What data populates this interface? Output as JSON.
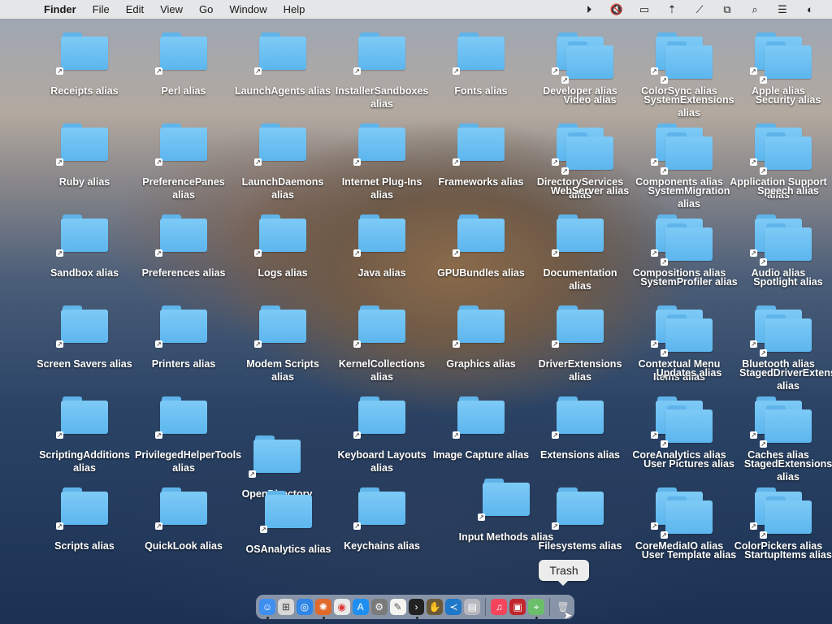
{
  "menubar": {
    "apple": "",
    "app": "Finder",
    "items": [
      "File",
      "Edit",
      "View",
      "Go",
      "Window",
      "Help"
    ],
    "status_icons": [
      "play-icon",
      "mute-icon",
      "display-icon",
      "airdrop-icon",
      "wifi-off-icon",
      "mirroring-icon",
      "search-icon",
      "control-center-icon",
      "siri-icon"
    ]
  },
  "desktop_labels": {
    "r0": [
      "Receipts alias",
      "Perl alias",
      "LaunchAgents alias",
      "InstallerSandboxes alias",
      "Fonts alias",
      "Developer alias",
      "ColorSync alias",
      "Apple alias"
    ],
    "r0b": [
      "Video alias",
      "SystemExtensions alias",
      "Security alias"
    ],
    "r1": [
      "Ruby alias",
      "PreferencePanes alias",
      "LaunchDaemons alias",
      "Internet Plug-Ins alias",
      "Frameworks alias",
      "DirectoryServices alias",
      "Components alias",
      "Application Support alias"
    ],
    "r1b": [
      "WebServer alias",
      "SystemMigration alias",
      "Speech alias"
    ],
    "r2": [
      "Sandbox alias",
      "Preferences alias",
      "Logs alias",
      "Java alias",
      "GPUBundles alias",
      "Documentation alias",
      "Compositions alias",
      "Audio alias"
    ],
    "r2b": [
      "SystemProfiler alias",
      "Spotlight alias"
    ],
    "r3": [
      "Screen Savers alias",
      "Printers alias",
      "Modem Scripts alias",
      "KernelCollections alias",
      "Graphics alias",
      "DriverExtensions alias",
      "Contextual Menu Items alias",
      "Bluetooth alias"
    ],
    "r3b": [
      "Updates alias",
      "StagedDriverExtensions alias"
    ],
    "r4": [
      "ScriptingAdditions alias",
      "PrivilegedHelperTools alias",
      "OpenDirectory",
      "Keyboard Layouts alias",
      "Image Capture alias",
      "Extensions alias",
      "CoreAnalytics alias",
      "Caches alias"
    ],
    "r4b": [
      "User Pictures alias",
      "StagedExtensions alias"
    ],
    "r5": [
      "Scripts alias",
      "QuickLook alias",
      "OSAnalytics alias",
      "Keychains alias",
      "Input Methods alias",
      "Filesystems alias",
      "CoreMediaIO alias",
      "ColorPickers alias"
    ],
    "r5b": [
      "User Template alias",
      "StartupItems alias"
    ]
  },
  "tooltip": {
    "text": "Trash"
  },
  "dock": {
    "apps": [
      "finder-icon",
      "launchpad-icon",
      "safari-icon",
      "firefox-icon",
      "chrome-icon",
      "app-store-icon",
      "system-preferences-icon",
      "textedit-icon",
      "terminal-icon",
      "automator-icon",
      "vscode-icon",
      "preview-icon",
      "music-icon",
      "photo-booth-icon",
      "maps-icon",
      "trash-icon"
    ]
  }
}
